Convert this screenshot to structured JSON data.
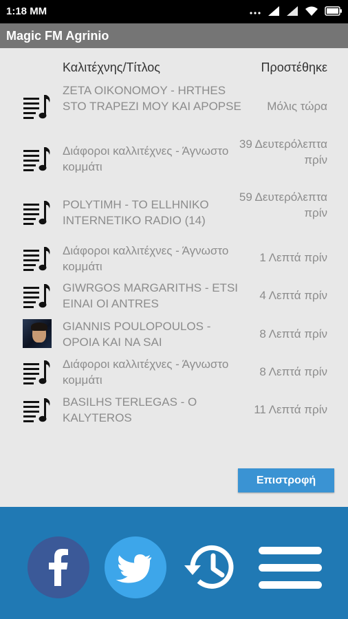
{
  "status_bar": {
    "time": "1:18 MM"
  },
  "app_bar": {
    "title": "Magic FM Agrinio"
  },
  "header": {
    "title_col": "Καλιτέχνης/Τίτλος",
    "added_col": "Προστέθηκε"
  },
  "songs": [
    {
      "title": "ZETA OIKONOMOY - HRTHES STO TRAPEZI MOY KAI APOPSE",
      "added": "Μόλις τώρα",
      "icon": "music-list-icon"
    },
    {
      "title": "Διάφοροι καλλιτέχνες - Άγνωστο κομμάτι",
      "added": "39 Δευτερόλεπτα πρίν",
      "icon": "music-list-icon"
    },
    {
      "title": "POLYTIMH - TO ELLHNIKO INTERNETIKO RADIO (14)",
      "added": "59 Δευτερόλεπτα πρίν",
      "icon": "music-list-icon"
    },
    {
      "title": "Διάφοροι καλλιτέχνες - Άγνωστο κομμάτι",
      "added": "1 Λεπτά πρίν",
      "icon": "music-list-icon"
    },
    {
      "title": "GIWRGOS MARGARITHS - ETSI EINAI OI ANTRES",
      "added": "4 Λεπτά πρίν",
      "icon": "music-list-icon"
    },
    {
      "title": "GIANNIS POULOPOULOS - OPOIA KAI NA SAI",
      "added": "8 Λεπτά πρίν",
      "icon": "album-art"
    },
    {
      "title": "Διάφοροι καλλιτέχνες - Άγνωστο κομμάτι",
      "added": "8 Λεπτά πρίν",
      "icon": "music-list-icon"
    },
    {
      "title": "BASILHS TERLEGAS - O KALYTEROS",
      "added": "11 Λεπτά πρίν",
      "icon": "music-list-icon"
    }
  ],
  "back_button": {
    "label": "Επιστροφή"
  },
  "bottom_bar": {
    "facebook_color": "#3b5998",
    "twitter_color": "#3da6ea",
    "bar_color": "#2079b4"
  }
}
